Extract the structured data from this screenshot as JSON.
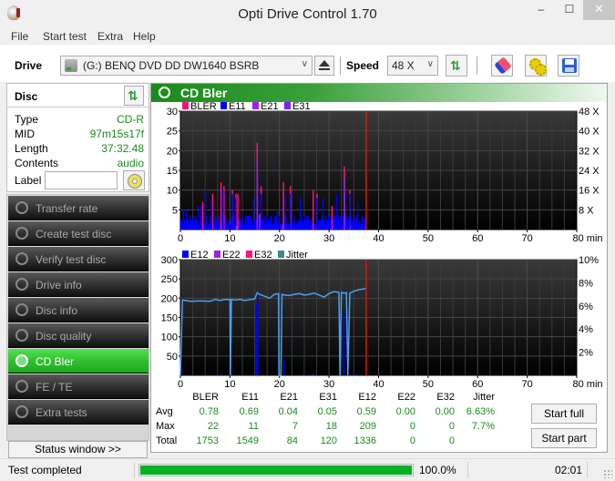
{
  "window": {
    "title": "Opti Drive Control 1.70",
    "controls": {
      "minimize": "‒",
      "maximize": "☐",
      "close": "✕"
    }
  },
  "menu": [
    "File",
    "Start test",
    "Extra",
    "Help"
  ],
  "toolbar": {
    "drive_label": "Drive",
    "drive_value": "(G:)  BENQ DVD DD DW1640 BSRB",
    "speed_label": "Speed",
    "speed_value": "48 X",
    "icons": [
      "drive-icon",
      "eject-icon",
      "refresh-icon",
      "erase-icon",
      "settings-icon",
      "save-icon"
    ]
  },
  "disc": {
    "title": "Disc",
    "rows": [
      {
        "key": "Type",
        "value": "CD-R"
      },
      {
        "key": "MID",
        "value": "97m15s17f"
      },
      {
        "key": "Length",
        "value": "37:32.48"
      },
      {
        "key": "Contents",
        "value": "audio"
      }
    ],
    "label_key": "Label",
    "label_value": ""
  },
  "nav": {
    "items": [
      {
        "label": "Transfer rate",
        "active": false
      },
      {
        "label": "Create test disc",
        "active": false
      },
      {
        "label": "Verify test disc",
        "active": false
      },
      {
        "label": "Drive info",
        "active": false
      },
      {
        "label": "Disc info",
        "active": false
      },
      {
        "label": "Disc quality",
        "active": false
      },
      {
        "label": "CD Bler",
        "active": true
      },
      {
        "label": "FE / TE",
        "active": false
      },
      {
        "label": "Extra tests",
        "active": false
      }
    ],
    "status_window": "Status window >>"
  },
  "panel": {
    "title": "CD Bler"
  },
  "colors": {
    "BLER": "#ff1080",
    "E11": "#0000ff",
    "E21": "#a020f0",
    "E31": "#8020ff",
    "E12": "#0000ff",
    "E22": "#a020f0",
    "E32": "#ff1080",
    "Jitter": "#3a8a8a",
    "jitter_line": "#4aa0f0",
    "marker": "#e01010",
    "progress": "#06b025"
  },
  "chart_data": [
    {
      "type": "bar",
      "title": "BLER / E11 / E21 / E31",
      "legend": [
        "BLER",
        "E11",
        "E21",
        "E31"
      ],
      "legend_placement": "top-left",
      "xlabel": "min",
      "x_ticks": [
        "0",
        "10",
        "20",
        "30",
        "40",
        "50",
        "60",
        "70",
        "80 min"
      ],
      "xlim": [
        0,
        80
      ],
      "y_ticks": [
        "5",
        "10",
        "15",
        "20",
        "25",
        "30"
      ],
      "ylim": [
        0,
        30
      ],
      "y2_ticks": [
        "8 X",
        "16 X",
        "24 X",
        "32 X",
        "40 X",
        "48 X"
      ],
      "y2lim": [
        0,
        48
      ],
      "end_marker_min": 37.5,
      "series": [
        {
          "name": "BLER",
          "peaks": [
            [
              4.5,
              7
            ],
            [
              6.5,
              9
            ],
            [
              8.2,
              12
            ],
            [
              8.8,
              11
            ],
            [
              10.5,
              10
            ],
            [
              11.2,
              9
            ],
            [
              11.6,
              9
            ],
            [
              15.5,
              22
            ],
            [
              16.3,
              11
            ],
            [
              20.8,
              12
            ],
            [
              22.2,
              11
            ],
            [
              26.8,
              10
            ],
            [
              27.6,
              9
            ],
            [
              30.6,
              6
            ],
            [
              33.1,
              16
            ],
            [
              34.2,
              10
            ]
          ]
        },
        {
          "name": "E11",
          "peaks": [
            [
              0.6,
              5
            ],
            [
              1.2,
              5
            ],
            [
              3.5,
              6
            ],
            [
              4.2,
              6
            ],
            [
              5.1,
              10
            ],
            [
              6.3,
              7
            ],
            [
              8.6,
              10
            ],
            [
              10.5,
              9
            ],
            [
              11.1,
              8
            ],
            [
              14.8,
              8
            ],
            [
              15.5,
              11
            ],
            [
              16.3,
              9
            ],
            [
              19.6,
              5
            ],
            [
              21.2,
              9
            ],
            [
              22.1,
              9
            ],
            [
              24.2,
              8
            ],
            [
              27.6,
              8
            ],
            [
              28.8,
              8
            ],
            [
              31.5,
              9
            ],
            [
              33.1,
              11
            ],
            [
              34.2,
              9
            ],
            [
              35.8,
              7
            ],
            [
              37.0,
              3
            ]
          ],
          "baseline": 1.5
        },
        {
          "name": "E21",
          "peaks": [
            [
              15.5,
              18
            ],
            [
              16.0,
              4
            ],
            [
              33.1,
              13
            ],
            [
              11.4,
              1
            ]
          ]
        },
        {
          "name": "E31",
          "peaks": [
            [
              6.5,
              0.5
            ],
            [
              11.1,
              1
            ],
            [
              15.5,
              14
            ],
            [
              20.5,
              1
            ],
            [
              34.2,
              1
            ]
          ]
        }
      ]
    },
    {
      "type": "line",
      "title": "E12 / E22 / E32 / Jitter",
      "legend": [
        "E12",
        "E22",
        "E32",
        "Jitter"
      ],
      "legend_placement": "top-left",
      "xlabel": "min",
      "x_ticks": [
        "0",
        "10",
        "20",
        "30",
        "40",
        "50",
        "60",
        "70",
        "80 min"
      ],
      "xlim": [
        0,
        80
      ],
      "y_ticks": [
        "50",
        "100",
        "150",
        "200",
        "250",
        "300"
      ],
      "ylim": [
        0,
        300
      ],
      "y2_ticks": [
        "2%",
        "4%",
        "6%",
        "8%",
        "10%"
      ],
      "y2lim": [
        0,
        10
      ],
      "end_marker_min": 37.5,
      "e12_spikes": [
        [
          8.2,
          5
        ],
        [
          15.3,
          185
        ],
        [
          15.6,
          209
        ],
        [
          20.9,
          40
        ],
        [
          26.8,
          5
        ],
        [
          33.0,
          165
        ],
        [
          35.6,
          5
        ]
      ],
      "jitter_points": [
        [
          0,
          0
        ],
        [
          0.2,
          95
        ],
        [
          0.4,
          195
        ],
        [
          2,
          192
        ],
        [
          4,
          193
        ],
        [
          6,
          192
        ],
        [
          7,
          197
        ],
        [
          8,
          194
        ],
        [
          9,
          197
        ],
        [
          10,
          196
        ],
        [
          10.1,
          0
        ],
        [
          10.3,
          197
        ],
        [
          11,
          195
        ],
        [
          12,
          197
        ],
        [
          13,
          194
        ],
        [
          14,
          196
        ],
        [
          15,
          198
        ],
        [
          15.5,
          214
        ],
        [
          16,
          210
        ],
        [
          17,
          205
        ],
        [
          18,
          200
        ],
        [
          19,
          210
        ],
        [
          19.8,
          212
        ],
        [
          19.9,
          0
        ],
        [
          20.3,
          0
        ],
        [
          20.5,
          210
        ],
        [
          21,
          208
        ],
        [
          22,
          207
        ],
        [
          23,
          210
        ],
        [
          24,
          212
        ],
        [
          25,
          208
        ],
        [
          26,
          210
        ],
        [
          27,
          213
        ],
        [
          28,
          208
        ],
        [
          29,
          203
        ],
        [
          30,
          212
        ],
        [
          31,
          217
        ],
        [
          32,
          215
        ],
        [
          32.2,
          0
        ],
        [
          32.5,
          215
        ],
        [
          33,
          213
        ],
        [
          33.5,
          214
        ],
        [
          33.8,
          0
        ],
        [
          34.2,
          213
        ],
        [
          35,
          218
        ],
        [
          36,
          222
        ],
        [
          37,
          224
        ],
        [
          37.4,
          226
        ]
      ]
    }
  ],
  "stats": {
    "columns": [
      "BLER",
      "E11",
      "E21",
      "E31",
      "E12",
      "E22",
      "E32",
      "Jitter"
    ],
    "rows": [
      {
        "label": "Avg",
        "values": [
          "0.78",
          "0.69",
          "0.04",
          "0.05",
          "0.59",
          "0.00",
          "0.00",
          "6.63%"
        ]
      },
      {
        "label": "Max",
        "values": [
          "22",
          "11",
          "7",
          "18",
          "209",
          "0",
          "0",
          "7.7%"
        ]
      },
      {
        "label": "Total",
        "values": [
          "1753",
          "1549",
          "84",
          "120",
          "1336",
          "0",
          "0",
          ""
        ]
      }
    ]
  },
  "buttons": {
    "start_full": "Start full",
    "start_part": "Start part"
  },
  "statusbar": {
    "status": "Test completed",
    "progress_percent": 100.0,
    "progress_text": "100.0%",
    "elapsed": "02:01"
  }
}
